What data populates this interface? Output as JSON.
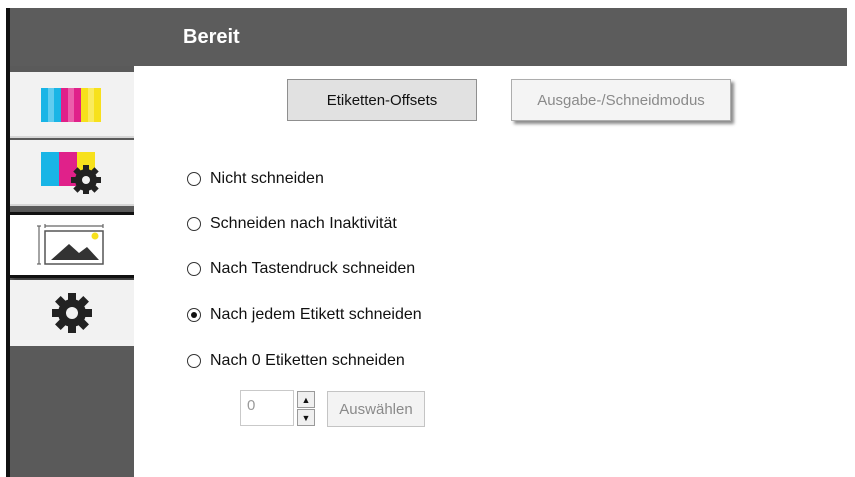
{
  "header": {
    "title": "Bereit"
  },
  "sidebar": {
    "tabs": [
      {
        "name": "ink-colors-icon",
        "selected": false
      },
      {
        "name": "ink-settings-icon",
        "selected": false
      },
      {
        "name": "label-image-icon",
        "selected": true
      },
      {
        "name": "gear-icon",
        "selected": false
      }
    ]
  },
  "toolbar": {
    "label_offsets_label": "Etiketten-Offsets",
    "output_cut_mode_label": "Ausgabe-/Schneidmodus"
  },
  "cut_options": [
    {
      "label": "Nicht schneiden",
      "checked": false
    },
    {
      "label": "Schneiden nach Inaktivität",
      "checked": false
    },
    {
      "label": "Nach Tastendruck schneiden",
      "checked": false
    },
    {
      "label": "Nach jedem Etikett schneiden",
      "checked": true
    },
    {
      "label": "Nach 0 Etiketten schneiden",
      "checked": false
    }
  ],
  "count": {
    "value": "0",
    "select_label": "Auswählen"
  },
  "colors": {
    "header_bg": "#5c5c5c",
    "sidebar_bg": "#5a5a5a",
    "cyan": "#19b5e6",
    "magenta": "#e0218a",
    "yellow": "#f7e11c"
  }
}
